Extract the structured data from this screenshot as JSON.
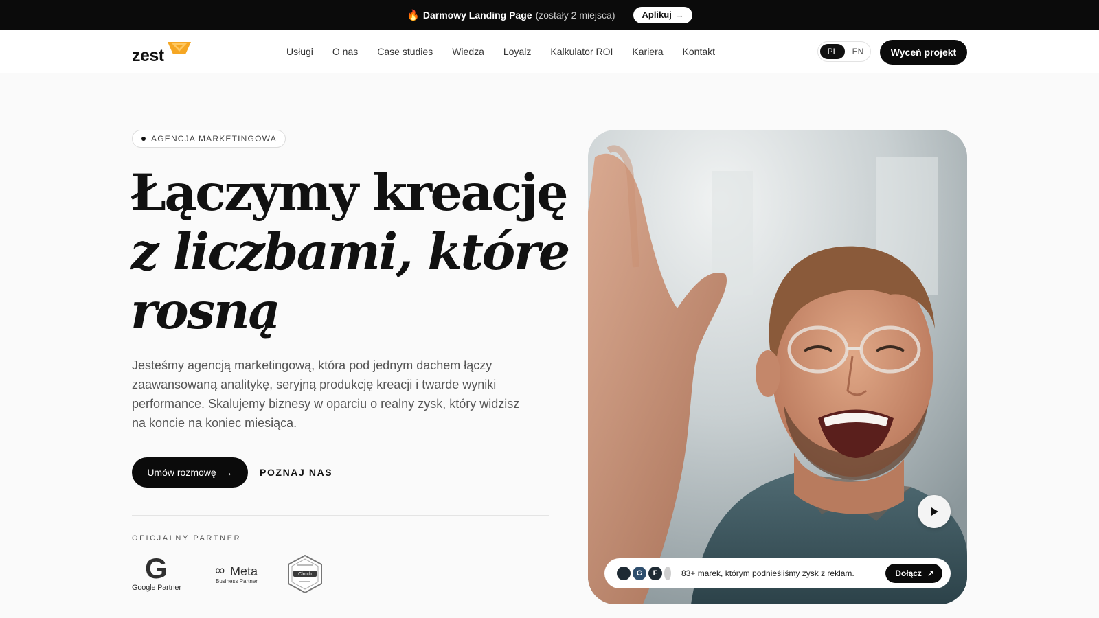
{
  "announcement": {
    "icon": "fire-icon",
    "title": "Darmowy Landing Page",
    "note": "(zostały 2 miejsca)",
    "button_label": "Aplikuj"
  },
  "header": {
    "logo_text": "zest",
    "nav": [
      {
        "label": "Usługi"
      },
      {
        "label": "O nas"
      },
      {
        "label": "Case studies"
      },
      {
        "label": "Wiedza"
      },
      {
        "label": "Loyalz"
      },
      {
        "label": "Kalkulator ROI"
      },
      {
        "label": "Kariera"
      },
      {
        "label": "Kontakt"
      }
    ],
    "lang": {
      "active": "PL",
      "other": "EN"
    },
    "cta_label": "Wyceń projekt"
  },
  "hero": {
    "badge": "AGENCJA MARKETINGOWA",
    "headline": {
      "line1": "Łączymy kreację",
      "line2": "z liczbami, które",
      "line3": "rosną"
    },
    "lead": "Jesteśmy agencją marketingową, która pod jednym dachem łączy zaawansowaną analitykę, seryjną produkcję kreacji i twarde wyniki performance. Skalujemy biznesy w oparciu o realny zysk, który widzisz na koncie na koniec miesiąca.",
    "primary_button": "Umów rozmowę",
    "secondary_link": "POZNAJ NAS"
  },
  "partners": {
    "label": "OFICJALNY PARTNER",
    "google": {
      "mark": "G",
      "text": "Google Partner"
    },
    "meta": {
      "mark": "∞",
      "name": "Meta",
      "text": "Business Partner"
    },
    "clutch": {
      "name": "Clutch"
    }
  },
  "media": {
    "proof_text": "83+ marek, którym podnieśliśmy zysk z reklam.",
    "proof_button": "Dołącz",
    "proof_logos": [
      "",
      "G",
      "F"
    ]
  },
  "colors": {
    "dark": "#0b0b0b",
    "accent": "#f5a623",
    "background": "#fafafa"
  }
}
